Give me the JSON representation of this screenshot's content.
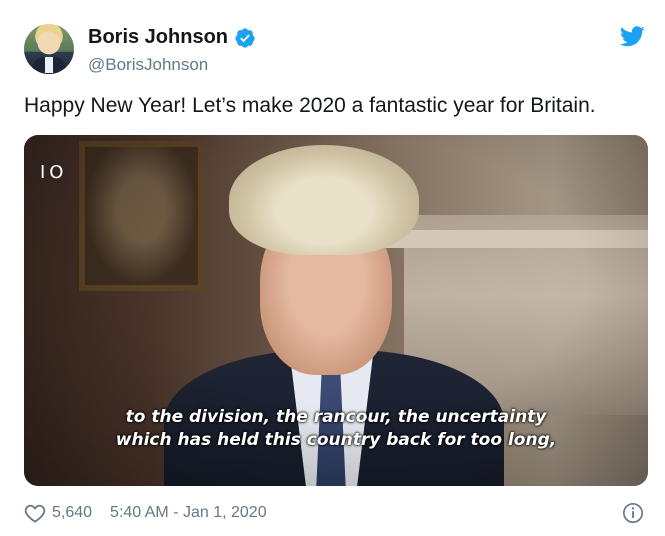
{
  "author": {
    "display_name": "Boris Johnson",
    "handle": "@BorisJohnson",
    "verified": true,
    "avatar_icon": "profile-photo"
  },
  "tweet": {
    "text": "Happy New Year! Let’s make 2020 a fantastic year for Britain."
  },
  "media": {
    "channel_logo": "IO",
    "caption_line1": "to the division, the rancour, the uncertainty",
    "caption_line2": "which has held this country back for too long,"
  },
  "footer": {
    "like_count": "5,640",
    "timestamp": "5:40 AM - Jan 1, 2020"
  },
  "icons": {
    "brand": "twitter-bird-icon",
    "verified": "verified-badge-icon",
    "like": "heart-icon",
    "info": "info-icon"
  },
  "colors": {
    "accent": "#1da1f2",
    "text": "#14171a",
    "secondary_text": "#657786"
  }
}
